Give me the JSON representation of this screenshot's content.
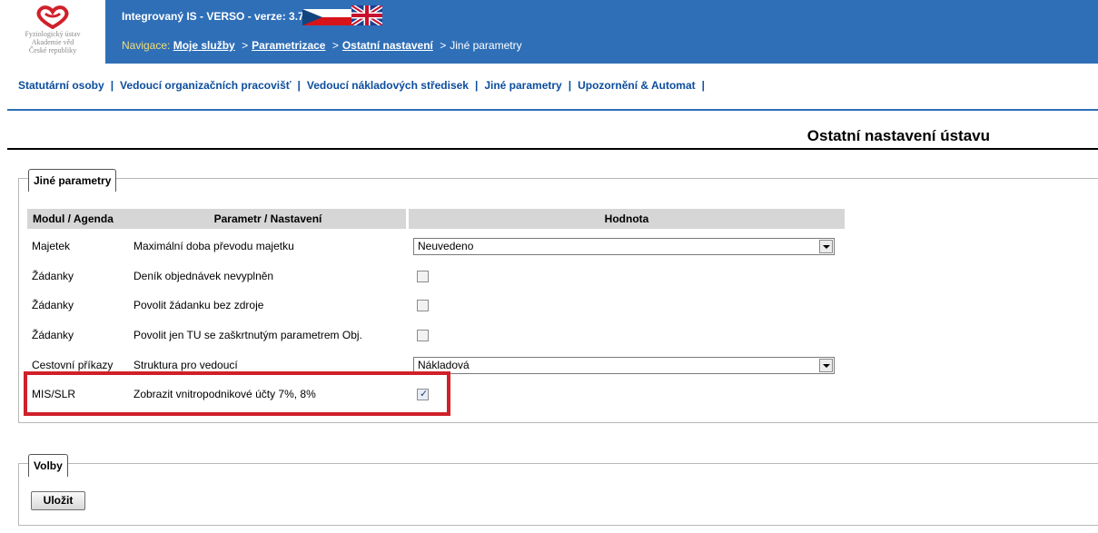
{
  "header": {
    "logo_lines": [
      "Fyziologický ústav",
      "Akademie věd",
      "České republiky"
    ],
    "app_title": "Integrovaný IS - VERSO - verze: 3.7.0.",
    "nav_prefix": "Navigace:",
    "breadcrumb": [
      {
        "label": "Moje služby",
        "link": true
      },
      {
        "label": "Parametrizace",
        "link": true
      },
      {
        "label": "Ostatní nastavení",
        "link": true
      },
      {
        "label": "Jiné parametry",
        "link": false
      }
    ],
    "brand_color": "#2f6fb7"
  },
  "tabs": [
    "Statutární osoby",
    "Vedoucí organizačních pracovišť",
    "Vedoucí nákladových středisek",
    "Jiné parametry",
    "Upozornění & Automat"
  ],
  "page_title": "Ostatní nastavení ústavu",
  "params_section": {
    "legend": "Jiné parametry",
    "columns": [
      "Modul / Agenda",
      "Parametr / Nastavení",
      "Hodnota"
    ],
    "rows": [
      {
        "module": "Majetek",
        "param": "Maximální doba převodu majetku",
        "type": "select",
        "value": "Neuvedeno"
      },
      {
        "module": "Žádanky",
        "param": "Deník objednávek nevyplněn",
        "type": "checkbox",
        "checked": false
      },
      {
        "module": "Žádanky",
        "param": "Povolit žádanku bez zdroje",
        "type": "checkbox",
        "checked": false
      },
      {
        "module": "Žádanky",
        "param": "Povolit jen TU se zaškrtnutým parametrem Obj.",
        "type": "checkbox",
        "checked": false
      },
      {
        "module": "Cestovní příkazy",
        "param": "Struktura pro vedoucí",
        "type": "select",
        "value": "Nákladová"
      },
      {
        "module": "MIS/SLR",
        "param": "Zobrazit vnitropodnikové účty 7%, 8%",
        "type": "checkbox",
        "checked": true
      }
    ]
  },
  "options_section": {
    "legend": "Volby",
    "save_label": "Uložit"
  },
  "highlight_color": "#d0202a"
}
